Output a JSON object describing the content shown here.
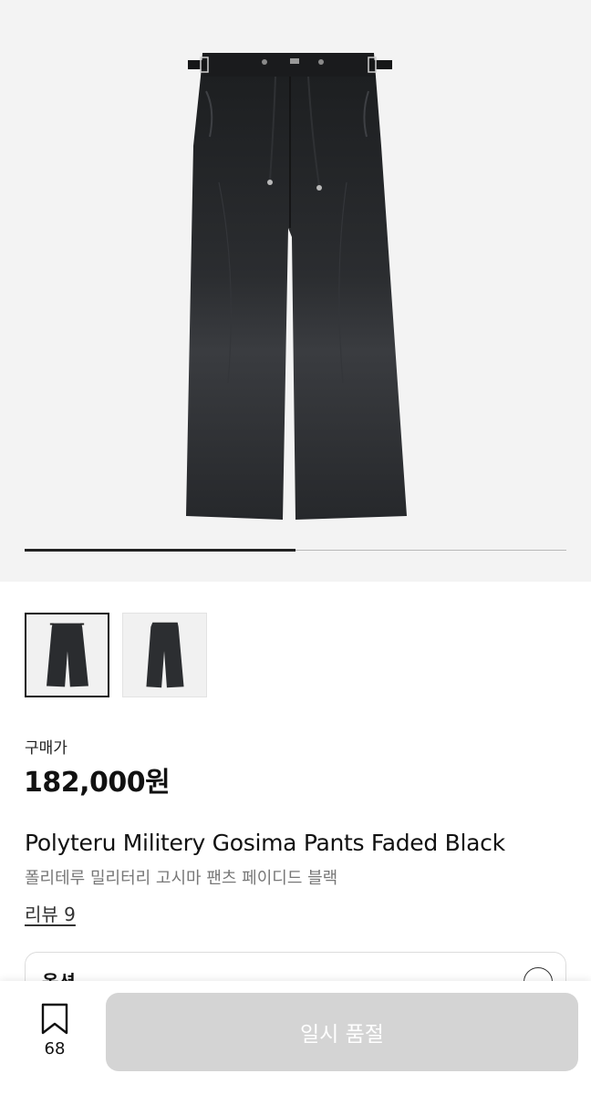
{
  "gallery": {
    "image_index": 1,
    "image_count": 2,
    "thumbnails": [
      {
        "name": "thumb-front",
        "selected": true
      },
      {
        "name": "thumb-angle",
        "selected": false
      }
    ]
  },
  "price": {
    "label": "구매가",
    "value": "182,000원"
  },
  "product": {
    "name_en": "Polyteru Militery Gosima Pants Faded Black",
    "name_ko": "폴리테루 밀리터리 고시마 팬츠 페이디드 블랙"
  },
  "reviews": {
    "label": "리뷰 9"
  },
  "option": {
    "label": "옵션"
  },
  "bottom_bar": {
    "bookmark_count": "68",
    "soldout_label": "일시 품절"
  },
  "colors": {
    "hero_background": "#f3f3f3",
    "progress_fill": "#222222",
    "disabled_button": "#d4d4d4"
  }
}
